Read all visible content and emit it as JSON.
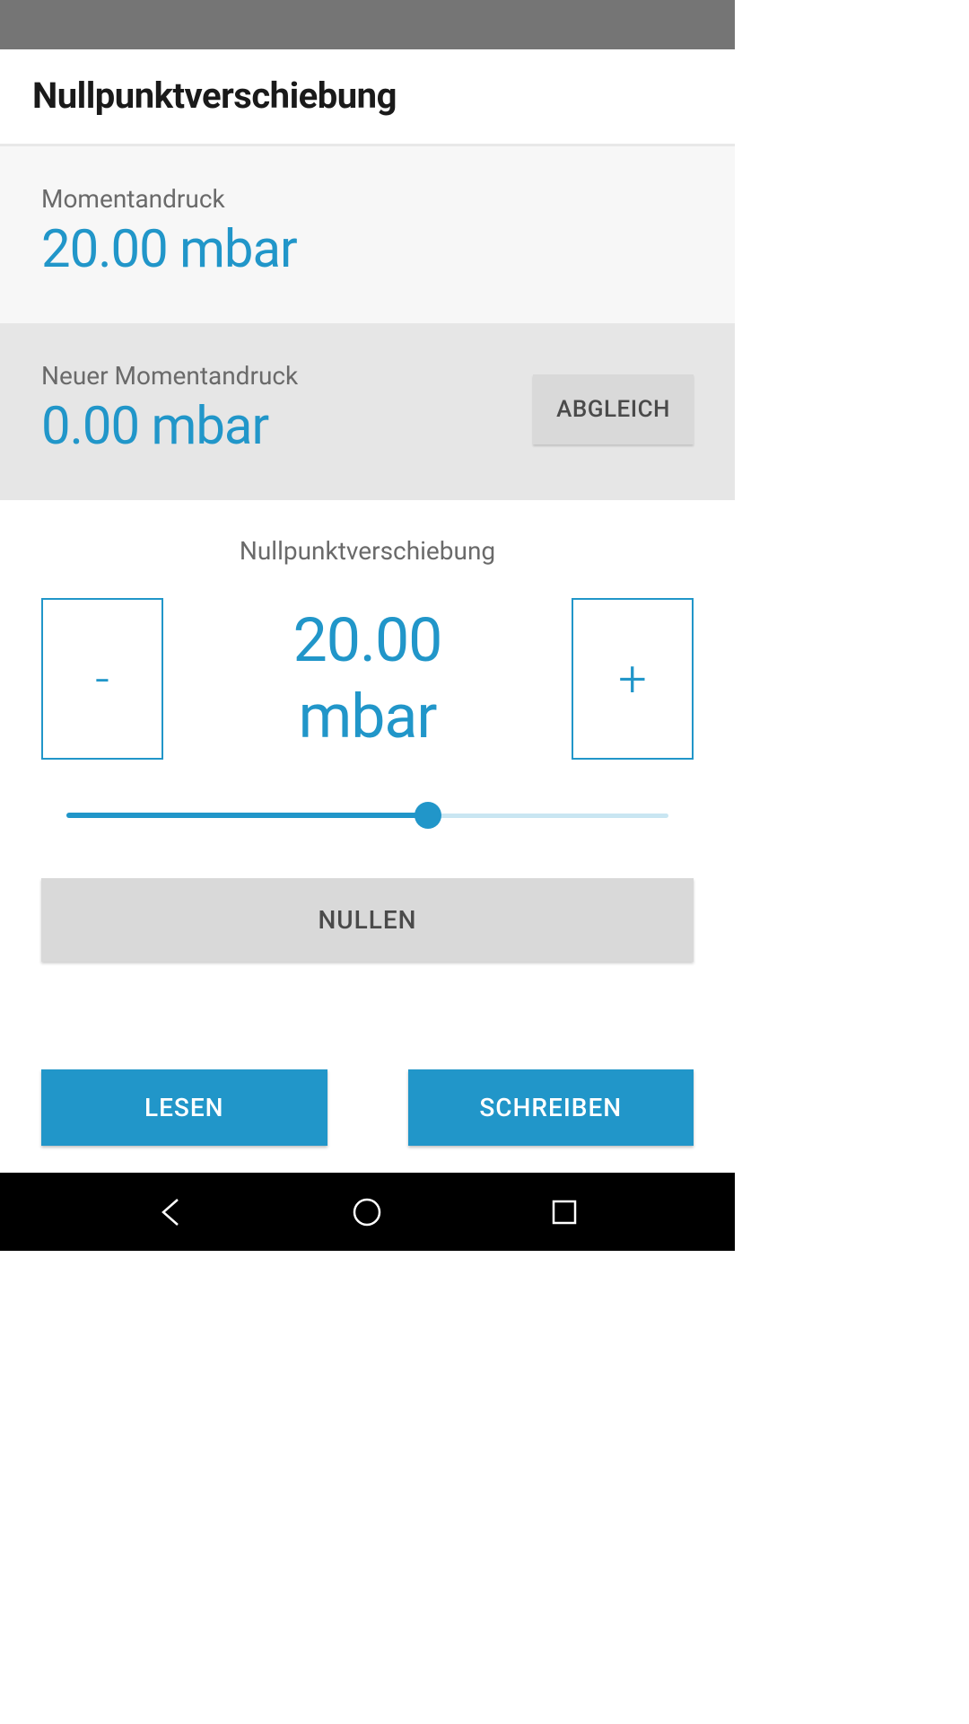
{
  "header": {
    "title": "Nullpunktverschiebung"
  },
  "current_pressure": {
    "label": "Momentandruck",
    "value": "20.00 mbar"
  },
  "new_pressure": {
    "label": "Neuer Momentandruck",
    "value": "0.00 mbar",
    "abgleich_label": "ABGLEICH"
  },
  "shift": {
    "label": "Nullpunktverschiebung",
    "minus_label": "-",
    "plus_label": "+",
    "value_line1": "20.00",
    "value_line2": "mbar",
    "slider_percent": 60,
    "nullen_label": "NULLEN"
  },
  "actions": {
    "read_label": "LESEN",
    "write_label": "SCHREIBEN"
  },
  "colors": {
    "accent": "#2196c9"
  }
}
